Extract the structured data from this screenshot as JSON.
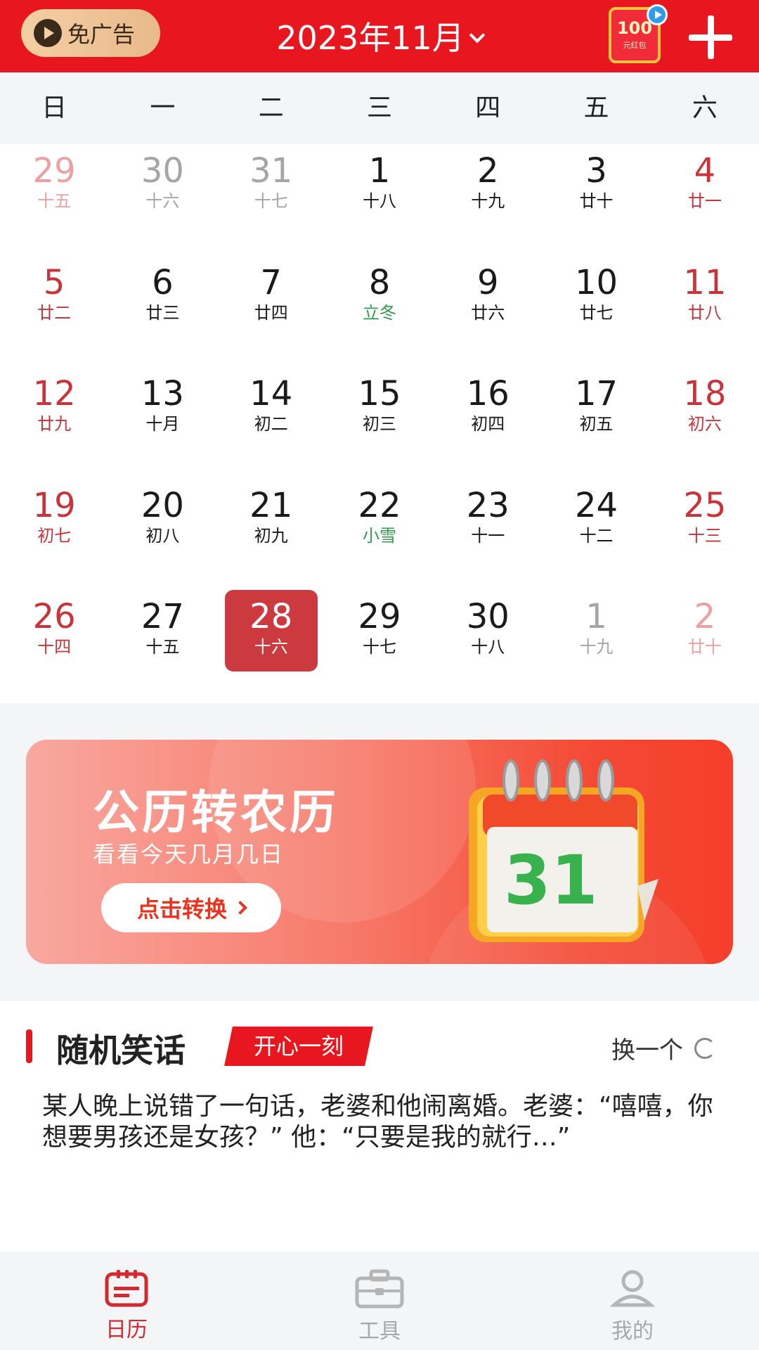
{
  "header": {
    "ad_label": "免广告",
    "month_title": "2023年11月",
    "redpacket_amount": "100",
    "redpacket_sub": "元红包",
    "accent_color": "#e8161e"
  },
  "weekdays": [
    "日",
    "一",
    "二",
    "三",
    "四",
    "五",
    "六"
  ],
  "calendar": {
    "rows": [
      [
        {
          "day": "29",
          "lunar": "十五",
          "style": "palered"
        },
        {
          "day": "30",
          "lunar": "十六",
          "style": "gray"
        },
        {
          "day": "31",
          "lunar": "十七",
          "style": "gray"
        },
        {
          "day": "1",
          "lunar": "十八",
          "style": "black"
        },
        {
          "day": "2",
          "lunar": "十九",
          "style": "black"
        },
        {
          "day": "3",
          "lunar": "廿十",
          "style": "black"
        },
        {
          "day": "4",
          "lunar": "廿一",
          "style": "red"
        }
      ],
      [
        {
          "day": "5",
          "lunar": "廿二",
          "style": "red"
        },
        {
          "day": "6",
          "lunar": "廿三",
          "style": "black"
        },
        {
          "day": "7",
          "lunar": "廿四",
          "style": "black"
        },
        {
          "day": "8",
          "lunar": "立冬",
          "style": "term"
        },
        {
          "day": "9",
          "lunar": "廿六",
          "style": "black"
        },
        {
          "day": "10",
          "lunar": "廿七",
          "style": "black"
        },
        {
          "day": "11",
          "lunar": "廿八",
          "style": "red"
        }
      ],
      [
        {
          "day": "12",
          "lunar": "廿九",
          "style": "red"
        },
        {
          "day": "13",
          "lunar": "十月",
          "style": "black"
        },
        {
          "day": "14",
          "lunar": "初二",
          "style": "black"
        },
        {
          "day": "15",
          "lunar": "初三",
          "style": "black"
        },
        {
          "day": "16",
          "lunar": "初四",
          "style": "black"
        },
        {
          "day": "17",
          "lunar": "初五",
          "style": "black"
        },
        {
          "day": "18",
          "lunar": "初六",
          "style": "red"
        }
      ],
      [
        {
          "day": "19",
          "lunar": "初七",
          "style": "red"
        },
        {
          "day": "20",
          "lunar": "初八",
          "style": "black"
        },
        {
          "day": "21",
          "lunar": "初九",
          "style": "black"
        },
        {
          "day": "22",
          "lunar": "小雪",
          "style": "term"
        },
        {
          "day": "23",
          "lunar": "十一",
          "style": "black"
        },
        {
          "day": "24",
          "lunar": "十二",
          "style": "black"
        },
        {
          "day": "25",
          "lunar": "十三",
          "style": "red"
        }
      ],
      [
        {
          "day": "26",
          "lunar": "十四",
          "style": "red"
        },
        {
          "day": "27",
          "lunar": "十五",
          "style": "black"
        },
        {
          "day": "28",
          "lunar": "十六",
          "style": "selected"
        },
        {
          "day": "29",
          "lunar": "十七",
          "style": "black"
        },
        {
          "day": "30",
          "lunar": "十八",
          "style": "black"
        },
        {
          "day": "1",
          "lunar": "十九",
          "style": "gray"
        },
        {
          "day": "2",
          "lunar": "廿十",
          "style": "palered"
        }
      ]
    ]
  },
  "banner": {
    "title": "公历转农历",
    "subtitle": "看看今天几月几日",
    "button_label": "点击转换",
    "illustration_number": "31"
  },
  "joke": {
    "title": "随机笑话",
    "tag": "开心一刻",
    "refresh_label": "换一个",
    "text": "某人晚上说错了一句话，老婆和他闹离婚。老婆：“嘻嘻，你想要男孩还是女孩？” 他：“只要是我的就行…”"
  },
  "bottom_nav": [
    {
      "label": "日历",
      "icon": "calendar-icon",
      "active": true
    },
    {
      "label": "工具",
      "icon": "toolbox-icon",
      "active": false
    },
    {
      "label": "我的",
      "icon": "profile-icon",
      "active": false
    }
  ]
}
